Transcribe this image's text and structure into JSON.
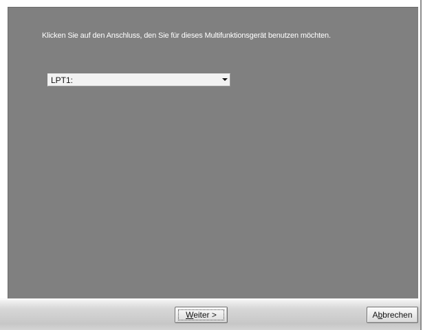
{
  "wizard": {
    "instruction": "Klicken Sie auf den Anschluss, den Sie für dieses Multifunktionsgerät benutzen möchten.",
    "port_select": {
      "selected": "LPT1:"
    },
    "buttons": {
      "next": {
        "mnemonic": "W",
        "rest": "eiter >"
      },
      "cancel": {
        "before": "A",
        "mnemonic": "b",
        "after": "brechen"
      }
    }
  },
  "colors": {
    "panel_background": "#808080",
    "footer_background": "#d2d2d2",
    "instruction_text": "#ffffff"
  }
}
